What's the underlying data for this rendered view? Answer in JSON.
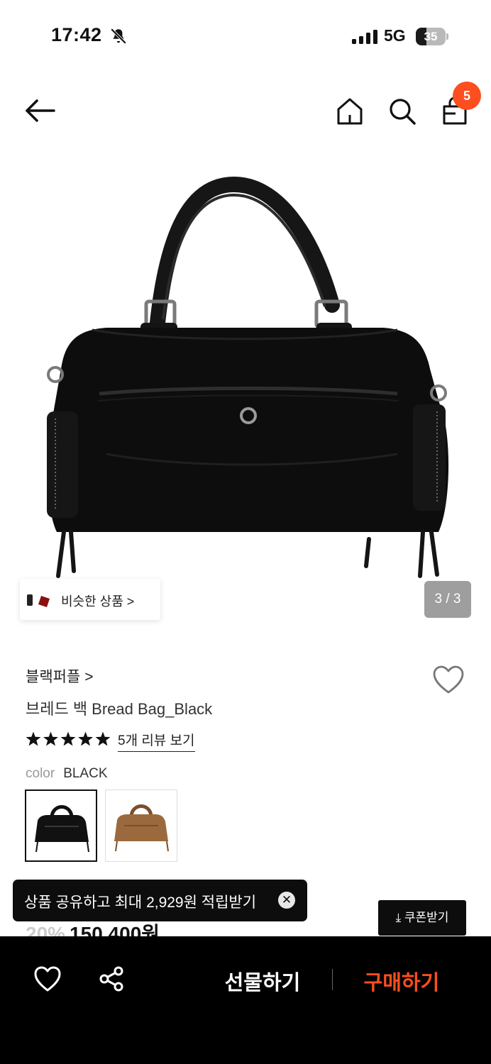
{
  "status_bar": {
    "time": "17:42",
    "network": "5G",
    "battery": "35",
    "battery_level_percent": 35,
    "icons": [
      "bell-slash-icon",
      "cellular-signal-icon",
      "battery-icon"
    ]
  },
  "header": {
    "icons": [
      "back-arrow-icon",
      "home-icon",
      "search-icon",
      "shopping-bag-icon"
    ],
    "cart_count": "5"
  },
  "gallery": {
    "similar_label": "비슷한 상품 >",
    "counter": "3 / 3"
  },
  "product": {
    "brand": "블랙퍼플",
    "brand_chevron": ">",
    "title": "브레드 백 Bread Bag_Black",
    "rating_stars": 5,
    "review_link": "5개 리뷰 보기",
    "option_label": "color",
    "option_value": "BLACK",
    "swatches": [
      {
        "name": "BLACK",
        "color": "#111111"
      },
      {
        "name": "BROWN",
        "color": "#9a6a3e"
      }
    ],
    "discount": "20%",
    "price": "150,400원"
  },
  "toast": {
    "text": "상품 공유하고 최대 2,929원 적립받기",
    "close_glyph": "✕"
  },
  "coupon_button": "⤓ 쿠폰받기",
  "bottom_bar": {
    "gift_label": "선물하기",
    "buy_label": "구매하기"
  },
  "colors": {
    "accent": "#fc4e1e",
    "dark": "#0d0d0d"
  }
}
